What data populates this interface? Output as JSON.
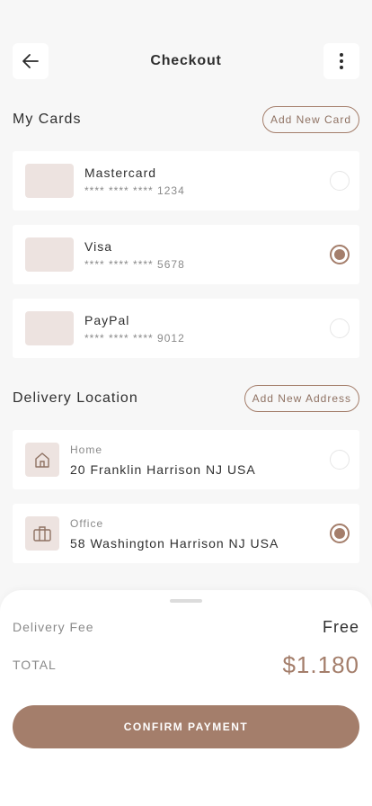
{
  "header": {
    "title": "Checkout",
    "back_icon": "arrow-left-icon",
    "menu_icon": "more-vertical-icon"
  },
  "cards_section": {
    "title": "My Cards",
    "add_label": "Add New Card",
    "items": [
      {
        "name": "Mastercard",
        "number": "**** **** **** 1234",
        "selected": false
      },
      {
        "name": "Visa",
        "number": "**** **** **** 5678",
        "selected": true
      },
      {
        "name": "PayPal",
        "number": "**** **** **** 9012",
        "selected": false
      }
    ]
  },
  "delivery_section": {
    "title": "Delivery Location",
    "add_label": "Add New Address",
    "items": [
      {
        "label": "Home",
        "address": "20 Franklin Harrison NJ USA",
        "icon": "home-icon",
        "selected": false
      },
      {
        "label": "Office",
        "address": "58 Washington Harrison NJ USA",
        "icon": "briefcase-icon",
        "selected": true
      }
    ]
  },
  "summary": {
    "fee_label": "Delivery Fee",
    "fee_value": "Free",
    "total_label": "TOTAL",
    "total_value": "$1.180",
    "confirm_label": "CONFIRM PAYMENT"
  },
  "colors": {
    "accent": "#a47e6b",
    "thumb": "#ede3e0",
    "background": "#f7f7f7"
  }
}
